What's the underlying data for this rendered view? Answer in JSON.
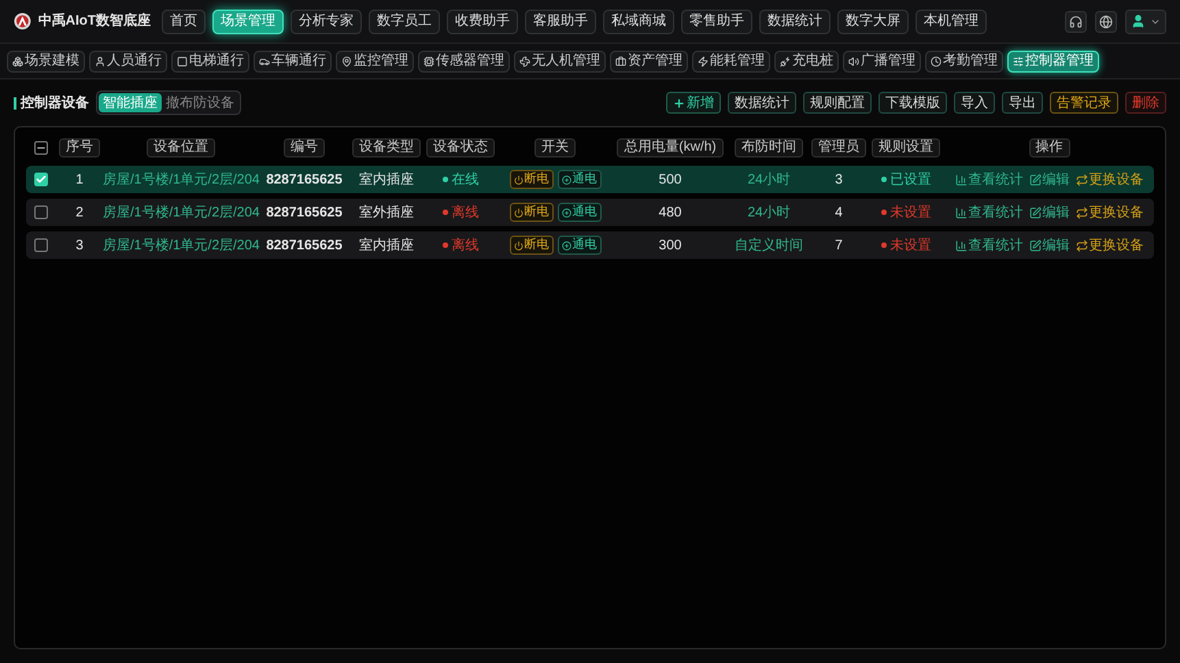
{
  "brand": {
    "name": "中禹AIoT数智底座"
  },
  "nav": [
    {
      "label": "首页",
      "selected": false
    },
    {
      "label": "场景管理",
      "selected": true
    },
    {
      "label": "分析专家",
      "selected": false
    },
    {
      "label": "数字员工",
      "selected": false
    },
    {
      "label": "收费助手",
      "selected": false
    },
    {
      "label": "客服助手",
      "selected": false
    },
    {
      "label": "私域商城",
      "selected": false
    },
    {
      "label": "零售助手",
      "selected": false
    },
    {
      "label": "数据统计",
      "selected": false
    },
    {
      "label": "数字大屏",
      "selected": false
    },
    {
      "label": "本机管理",
      "selected": false
    }
  ],
  "subnav": [
    {
      "label": "场景建模",
      "selected": false
    },
    {
      "label": "人员通行",
      "selected": false
    },
    {
      "label": "电梯通行",
      "selected": false
    },
    {
      "label": "车辆通行",
      "selected": false
    },
    {
      "label": "监控管理",
      "selected": false
    },
    {
      "label": "传感器管理",
      "selected": false
    },
    {
      "label": "无人机管理",
      "selected": false
    },
    {
      "label": "资产管理",
      "selected": false
    },
    {
      "label": "能耗管理",
      "selected": false
    },
    {
      "label": "充电桩",
      "selected": false
    },
    {
      "label": "广播管理",
      "selected": false
    },
    {
      "label": "考勤管理",
      "selected": false
    },
    {
      "label": "控制器管理",
      "selected": true
    }
  ],
  "page": {
    "title": "控制器设备",
    "tabs": [
      {
        "label": "智能插座",
        "selected": true
      },
      {
        "label": "撤布防设备",
        "selected": false
      }
    ]
  },
  "actions": [
    {
      "label": "新增",
      "kind": "add"
    },
    {
      "label": "数据统计",
      "kind": "normal"
    },
    {
      "label": "规则配置",
      "kind": "normal"
    },
    {
      "label": "下载模版",
      "kind": "normal"
    },
    {
      "label": "导入",
      "kind": "normal"
    },
    {
      "label": "导出",
      "kind": "normal"
    },
    {
      "label": "告警记录",
      "kind": "warn"
    },
    {
      "label": "删除",
      "kind": "danger"
    }
  ],
  "table": {
    "select_all_partial": true,
    "columns": [
      "序号",
      "设备位置",
      "编号",
      "设备类型",
      "设备状态",
      "开关",
      "总用电量(kw/h)",
      "布防时间",
      "管理员",
      "规则设置",
      "操作"
    ],
    "rows": [
      {
        "selected": true,
        "index": "1",
        "location": "房屋/1号楼/1单元/2层/204",
        "code": "8287165625",
        "type": "室内插座",
        "status": {
          "label": "在线",
          "online": true
        },
        "switch": [
          "断电",
          "通电"
        ],
        "power": "500",
        "guard_time": "24小时",
        "admins": "3",
        "rule": {
          "label": "已设置",
          "set": true
        },
        "ops": [
          "查看统计",
          "编辑",
          "更换设备"
        ]
      },
      {
        "selected": false,
        "index": "2",
        "location": "房屋/1号楼/1单元/2层/204",
        "code": "8287165625",
        "type": "室外插座",
        "status": {
          "label": "离线",
          "online": false
        },
        "switch": [
          "断电",
          "通电"
        ],
        "power": "480",
        "guard_time": "24小时",
        "admins": "4",
        "rule": {
          "label": "未设置",
          "set": false
        },
        "ops": [
          "查看统计",
          "编辑",
          "更换设备"
        ]
      },
      {
        "selected": false,
        "index": "3",
        "location": "房屋/1号楼/1单元/2层/204",
        "code": "8287165625",
        "type": "室内插座",
        "status": {
          "label": "离线",
          "online": false
        },
        "switch": [
          "断电",
          "通电"
        ],
        "power": "300",
        "guard_time": "自定义时间",
        "admins": "7",
        "rule": {
          "label": "未设置",
          "set": false
        },
        "ops": [
          "查看统计",
          "编辑",
          "更换设备"
        ]
      }
    ]
  }
}
